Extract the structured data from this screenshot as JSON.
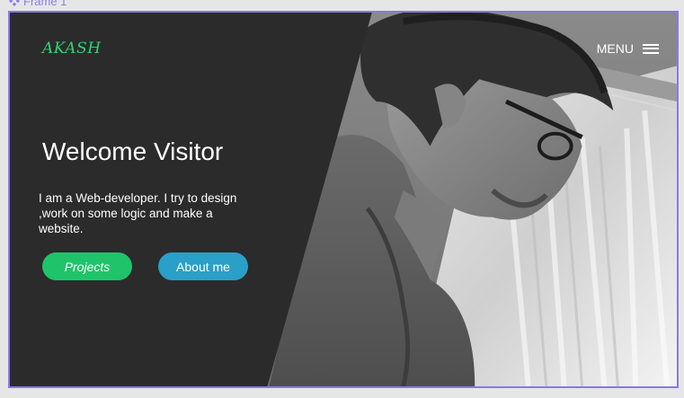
{
  "canvas": {
    "frame_label": "Frame 1"
  },
  "header": {
    "logo": "AKASH",
    "menu_label": "MENU"
  },
  "hero": {
    "title": "Welcome Visitor",
    "description": "I am a Web-developer. I try to design ,work on some logic and make a website.",
    "buttons": {
      "projects": "Projects",
      "about": "About me"
    }
  },
  "colors": {
    "panel": "#2b2b2b",
    "accent_green": "#1fc46a",
    "logo_green": "#2ed573",
    "accent_blue": "#2a9fc7",
    "frame_border": "#8878ec"
  },
  "icons": {
    "frame": "frame-icon",
    "menu": "hamburger-icon"
  }
}
